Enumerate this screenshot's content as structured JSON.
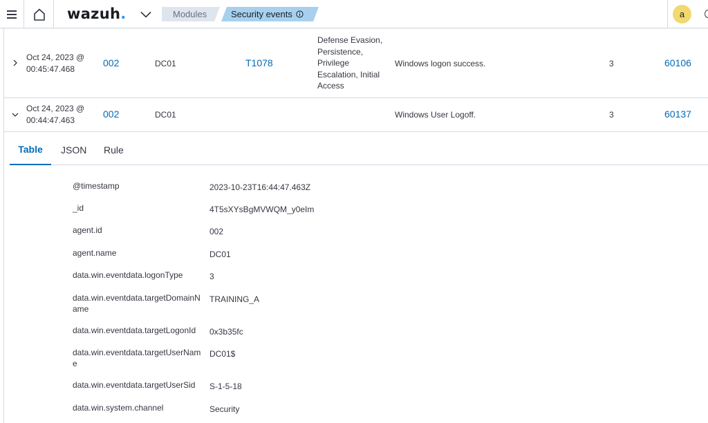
{
  "header": {
    "logo_text": "wazuh",
    "logo_dot": ".",
    "breadcrumbs": [
      {
        "label": "Modules"
      },
      {
        "label": "Security events"
      }
    ],
    "user_initial": "a",
    "accent_color": "#006bb8",
    "logo_dot_color": "#3595f9",
    "avatar_color": "#f1d86f"
  },
  "rows": [
    {
      "expanded": false,
      "time_line1": "Oct 24, 2023 @",
      "time_line2": "00:45:47.468",
      "agent_id": "002",
      "agent_name": "DC01",
      "technique": "T1078",
      "tactics": [
        "Defense Evasion,",
        "Persistence,",
        "Privilege",
        "Escalation, Initial",
        "Access"
      ],
      "description": "Windows logon success.",
      "level": "3",
      "rule_id": "60106"
    },
    {
      "expanded": true,
      "time_line1": "Oct 24, 2023 @",
      "time_line2": "00:44:47.463",
      "agent_id": "002",
      "agent_name": "DC01",
      "technique": "",
      "tactics": [],
      "description": "Windows User Logoff.",
      "level": "3",
      "rule_id": "60137"
    }
  ],
  "detail": {
    "tabs": [
      {
        "label": "Table",
        "active": true
      },
      {
        "label": "JSON",
        "active": false
      },
      {
        "label": "Rule",
        "active": false
      }
    ],
    "fields": [
      {
        "key": "@timestamp",
        "value": "2023-10-23T16:44:47.463Z"
      },
      {
        "key": "_id",
        "value": "4T5sXYsBgMVWQM_y0eIm"
      },
      {
        "key": "agent.id",
        "value": "002"
      },
      {
        "key": "agent.name",
        "value": "DC01"
      },
      {
        "key": "data.win.eventdata.logonType",
        "value": "3"
      },
      {
        "key": "data.win.eventdata.targetDomainName",
        "value": "TRAINING_A"
      },
      {
        "key": "data.win.eventdata.targetLogonId",
        "value": "0x3b35fc"
      },
      {
        "key": "data.win.eventdata.targetUserName",
        "value": "DC01$"
      },
      {
        "key": "data.win.eventdata.targetUserSid",
        "value": "S-1-5-18"
      },
      {
        "key": "data.win.system.channel",
        "value": "Security"
      }
    ]
  }
}
